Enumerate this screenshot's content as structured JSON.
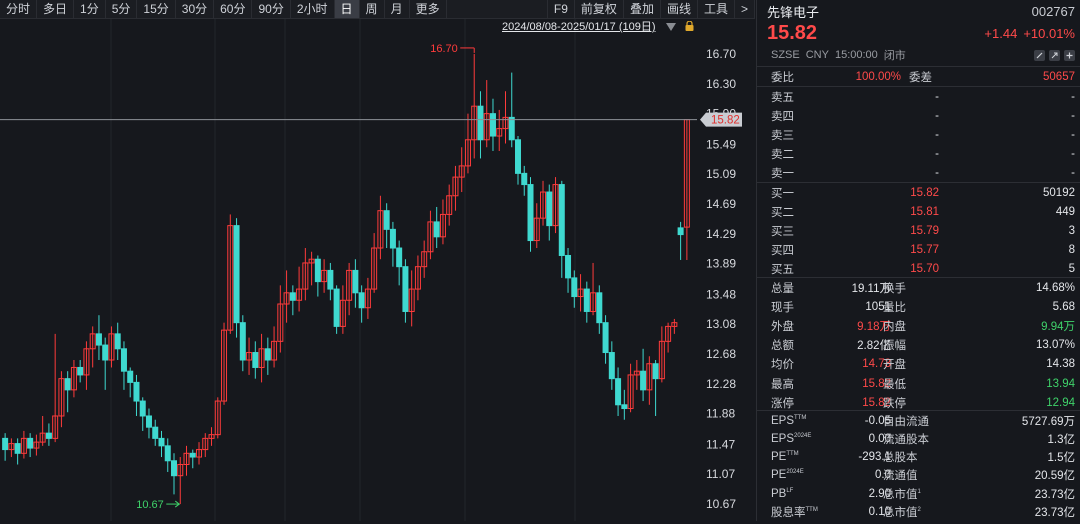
{
  "toolbar": {
    "tabs": [
      "分时",
      "多日",
      "1分",
      "5分",
      "15分",
      "30分",
      "60分",
      "90分",
      "2小时",
      "日",
      "周",
      "月",
      "更多"
    ],
    "active_index": 9,
    "right_tabs": [
      "F9",
      "前复权",
      "叠加",
      "画线",
      "工具",
      ">"
    ]
  },
  "chart": {
    "range_label": "2024/08/08-2025/01/17 (109日)",
    "price_axis": [
      "16.70",
      "16.30",
      "15.90",
      "15.49",
      "15.09",
      "14.69",
      "14.29",
      "13.89",
      "13.48",
      "13.08",
      "12.68",
      "12.28",
      "11.88",
      "11.47",
      "11.07",
      "10.67"
    ],
    "current_price_tag": "15.82",
    "high_marker": "16.70",
    "low_marker": "10.67",
    "colors": {
      "up": "#ff3b3b",
      "down": "#3fd9d0",
      "bg": "#16181d",
      "grid": "#23262c"
    }
  },
  "chart_data": {
    "type": "candlestick",
    "ylim": [
      10.47,
      16.9
    ],
    "candles": [
      {
        "o": 11.55,
        "c": 11.4,
        "h": 11.62,
        "l": 11.25
      },
      {
        "o": 11.4,
        "c": 11.48,
        "h": 11.55,
        "l": 11.3
      },
      {
        "o": 11.48,
        "c": 11.35,
        "h": 11.55,
        "l": 11.2
      },
      {
        "o": 11.35,
        "c": 11.55,
        "h": 11.65,
        "l": 11.28
      },
      {
        "o": 11.55,
        "c": 11.42,
        "h": 11.62,
        "l": 11.3
      },
      {
        "o": 11.42,
        "c": 11.5,
        "h": 11.6,
        "l": 11.32
      },
      {
        "o": 11.5,
        "c": 11.62,
        "h": 11.85,
        "l": 11.45
      },
      {
        "o": 11.62,
        "c": 11.55,
        "h": 11.75,
        "l": 11.45
      },
      {
        "o": 11.55,
        "c": 11.85,
        "h": 12.95,
        "l": 11.5
      },
      {
        "o": 11.85,
        "c": 12.35,
        "h": 12.45,
        "l": 11.7
      },
      {
        "o": 12.35,
        "c": 12.2,
        "h": 12.45,
        "l": 11.9
      },
      {
        "o": 12.2,
        "c": 12.5,
        "h": 12.6,
        "l": 12.1
      },
      {
        "o": 12.5,
        "c": 12.4,
        "h": 12.6,
        "l": 12.3
      },
      {
        "o": 12.4,
        "c": 12.75,
        "h": 12.85,
        "l": 12.2
      },
      {
        "o": 12.75,
        "c": 12.95,
        "h": 13.05,
        "l": 12.5
      },
      {
        "o": 12.95,
        "c": 12.8,
        "h": 13.2,
        "l": 12.6
      },
      {
        "o": 12.8,
        "c": 12.6,
        "h": 12.9,
        "l": 12.2
      },
      {
        "o": 12.6,
        "c": 12.95,
        "h": 13.05,
        "l": 12.5
      },
      {
        "o": 12.95,
        "c": 12.75,
        "h": 13.1,
        "l": 12.6
      },
      {
        "o": 12.75,
        "c": 12.45,
        "h": 12.85,
        "l": 12.2
      },
      {
        "o": 12.45,
        "c": 12.3,
        "h": 12.5,
        "l": 12.1
      },
      {
        "o": 12.3,
        "c": 12.05,
        "h": 12.4,
        "l": 11.85
      },
      {
        "o": 12.05,
        "c": 11.85,
        "h": 12.1,
        "l": 11.65
      },
      {
        "o": 11.85,
        "c": 11.7,
        "h": 11.95,
        "l": 11.55
      },
      {
        "o": 11.7,
        "c": 11.55,
        "h": 11.8,
        "l": 11.45
      },
      {
        "o": 11.55,
        "c": 11.45,
        "h": 11.65,
        "l": 11.3
      },
      {
        "o": 11.45,
        "c": 11.25,
        "h": 11.55,
        "l": 11.1
      },
      {
        "o": 11.25,
        "c": 11.05,
        "h": 11.35,
        "l": 10.8
      },
      {
        "o": 11.05,
        "c": 11.2,
        "h": 11.3,
        "l": 10.67
      },
      {
        "o": 11.2,
        "c": 11.35,
        "h": 11.45,
        "l": 11.05
      },
      {
        "o": 11.35,
        "c": 11.3,
        "h": 11.4,
        "l": 11.15
      },
      {
        "o": 11.3,
        "c": 11.4,
        "h": 11.5,
        "l": 11.2
      },
      {
        "o": 11.4,
        "c": 11.55,
        "h": 11.62,
        "l": 11.3
      },
      {
        "o": 11.55,
        "c": 11.6,
        "h": 11.7,
        "l": 11.45
      },
      {
        "o": 11.6,
        "c": 12.05,
        "h": 12.1,
        "l": 11.55
      },
      {
        "o": 12.05,
        "c": 13.0,
        "h": 13.1,
        "l": 12.0
      },
      {
        "o": 13.0,
        "c": 14.4,
        "h": 14.55,
        "l": 12.95
      },
      {
        "o": 14.4,
        "c": 13.1,
        "h": 14.5,
        "l": 12.9
      },
      {
        "o": 13.1,
        "c": 12.6,
        "h": 13.2,
        "l": 12.45
      },
      {
        "o": 12.6,
        "c": 12.7,
        "h": 12.9,
        "l": 12.4
      },
      {
        "o": 12.7,
        "c": 12.5,
        "h": 12.85,
        "l": 12.35
      },
      {
        "o": 12.5,
        "c": 12.75,
        "h": 12.95,
        "l": 12.3
      },
      {
        "o": 12.75,
        "c": 12.6,
        "h": 12.9,
        "l": 12.4
      },
      {
        "o": 12.6,
        "c": 12.85,
        "h": 13.05,
        "l": 12.5
      },
      {
        "o": 12.85,
        "c": 13.35,
        "h": 13.6,
        "l": 12.7
      },
      {
        "o": 13.35,
        "c": 13.5,
        "h": 13.8,
        "l": 13.1
      },
      {
        "o": 13.5,
        "c": 13.4,
        "h": 13.6,
        "l": 13.2
      },
      {
        "o": 13.4,
        "c": 13.55,
        "h": 13.85,
        "l": 13.25
      },
      {
        "o": 13.55,
        "c": 13.9,
        "h": 14.1,
        "l": 13.4
      },
      {
        "o": 13.9,
        "c": 13.95,
        "h": 14.05,
        "l": 13.6
      },
      {
        "o": 13.95,
        "c": 13.65,
        "h": 14.0,
        "l": 13.45
      },
      {
        "o": 13.65,
        "c": 13.8,
        "h": 13.95,
        "l": 13.5
      },
      {
        "o": 13.8,
        "c": 13.55,
        "h": 13.9,
        "l": 13.4
      },
      {
        "o": 13.55,
        "c": 13.05,
        "h": 13.6,
        "l": 12.95
      },
      {
        "o": 13.05,
        "c": 13.4,
        "h": 13.6,
        "l": 12.95
      },
      {
        "o": 13.4,
        "c": 13.8,
        "h": 13.9,
        "l": 13.2
      },
      {
        "o": 13.8,
        "c": 13.5,
        "h": 13.95,
        "l": 13.3
      },
      {
        "o": 13.5,
        "c": 13.3,
        "h": 13.6,
        "l": 13.1
      },
      {
        "o": 13.3,
        "c": 13.55,
        "h": 13.7,
        "l": 13.15
      },
      {
        "o": 13.55,
        "c": 14.1,
        "h": 14.3,
        "l": 13.5
      },
      {
        "o": 14.1,
        "c": 14.6,
        "h": 14.8,
        "l": 13.95
      },
      {
        "o": 14.6,
        "c": 14.35,
        "h": 14.7,
        "l": 14.1
      },
      {
        "o": 14.35,
        "c": 14.1,
        "h": 14.45,
        "l": 13.85
      },
      {
        "o": 14.1,
        "c": 13.85,
        "h": 14.2,
        "l": 13.6
      },
      {
        "o": 13.85,
        "c": 13.25,
        "h": 13.95,
        "l": 13.1
      },
      {
        "o": 13.25,
        "c": 13.55,
        "h": 13.8,
        "l": 13.05
      },
      {
        "o": 13.55,
        "c": 13.85,
        "h": 14.0,
        "l": 13.4
      },
      {
        "o": 13.85,
        "c": 14.05,
        "h": 14.2,
        "l": 13.7
      },
      {
        "o": 14.05,
        "c": 14.45,
        "h": 14.6,
        "l": 13.95
      },
      {
        "o": 14.45,
        "c": 14.25,
        "h": 14.65,
        "l": 14.1
      },
      {
        "o": 14.25,
        "c": 14.55,
        "h": 14.75,
        "l": 14.15
      },
      {
        "o": 14.55,
        "c": 14.8,
        "h": 14.95,
        "l": 14.4
      },
      {
        "o": 14.8,
        "c": 15.05,
        "h": 15.2,
        "l": 14.6
      },
      {
        "o": 15.05,
        "c": 15.2,
        "h": 15.45,
        "l": 14.85
      },
      {
        "o": 15.2,
        "c": 15.55,
        "h": 15.9,
        "l": 15.1
      },
      {
        "o": 15.55,
        "c": 16.0,
        "h": 16.7,
        "l": 15.3
      },
      {
        "o": 16.0,
        "c": 15.55,
        "h": 16.2,
        "l": 15.3
      },
      {
        "o": 15.55,
        "c": 15.9,
        "h": 16.35,
        "l": 15.45
      },
      {
        "o": 15.9,
        "c": 15.6,
        "h": 16.1,
        "l": 15.4
      },
      {
        "o": 15.6,
        "c": 15.7,
        "h": 15.95,
        "l": 15.4
      },
      {
        "o": 15.7,
        "c": 15.85,
        "h": 16.2,
        "l": 15.5
      },
      {
        "o": 15.85,
        "c": 15.55,
        "h": 16.45,
        "l": 15.45
      },
      {
        "o": 15.55,
        "c": 15.1,
        "h": 15.6,
        "l": 14.95
      },
      {
        "o": 15.1,
        "c": 14.95,
        "h": 15.2,
        "l": 14.8
      },
      {
        "o": 14.95,
        "c": 14.2,
        "h": 15.05,
        "l": 14.05
      },
      {
        "o": 14.2,
        "c": 14.5,
        "h": 14.7,
        "l": 14.1
      },
      {
        "o": 14.5,
        "c": 14.85,
        "h": 15.0,
        "l": 14.4
      },
      {
        "o": 14.85,
        "c": 14.4,
        "h": 14.95,
        "l": 14.2
      },
      {
        "o": 14.4,
        "c": 14.95,
        "h": 15.05,
        "l": 14.3
      },
      {
        "o": 14.95,
        "c": 14.0,
        "h": 15.0,
        "l": 13.7
      },
      {
        "o": 14.0,
        "c": 13.7,
        "h": 14.1,
        "l": 13.5
      },
      {
        "o": 13.7,
        "c": 13.45,
        "h": 13.8,
        "l": 13.3
      },
      {
        "o": 13.45,
        "c": 13.55,
        "h": 13.75,
        "l": 13.25
      },
      {
        "o": 13.55,
        "c": 13.25,
        "h": 13.65,
        "l": 13.1
      },
      {
        "o": 13.25,
        "c": 13.5,
        "h": 13.9,
        "l": 13.2
      },
      {
        "o": 13.5,
        "c": 13.1,
        "h": 13.6,
        "l": 12.95
      },
      {
        "o": 13.1,
        "c": 12.7,
        "h": 13.2,
        "l": 12.55
      },
      {
        "o": 12.7,
        "c": 12.35,
        "h": 12.85,
        "l": 12.2
      },
      {
        "o": 12.35,
        "c": 12.0,
        "h": 12.5,
        "l": 11.85
      },
      {
        "o": 12.0,
        "c": 11.95,
        "h": 12.2,
        "l": 11.8
      },
      {
        "o": 11.95,
        "c": 12.4,
        "h": 12.55,
        "l": 11.9
      },
      {
        "o": 12.4,
        "c": 12.45,
        "h": 12.6,
        "l": 12.2
      },
      {
        "o": 12.45,
        "c": 12.2,
        "h": 12.75,
        "l": 12.05
      },
      {
        "o": 12.2,
        "c": 12.55,
        "h": 12.65,
        "l": 12.0
      },
      {
        "o": 12.55,
        "c": 12.35,
        "h": 12.6,
        "l": 11.85
      },
      {
        "o": 12.35,
        "c": 12.85,
        "h": 13.05,
        "l": 12.3
      },
      {
        "o": 12.85,
        "c": 13.05,
        "h": 13.1,
        "l": 12.7
      },
      {
        "o": 13.05,
        "c": 13.1,
        "h": 13.15,
        "l": 12.95
      },
      {
        "o": 14.37,
        "c": 14.28,
        "h": 14.45,
        "l": 13.94
      },
      {
        "o": 14.38,
        "c": 15.82,
        "h": 15.82,
        "l": 13.94
      }
    ]
  },
  "header": {
    "name": "先锋电子",
    "code": "002767",
    "price": "15.82",
    "change": "+1.44",
    "change_pct": "+10.01%",
    "market": [
      "SZSE",
      "CNY",
      "15:00:00",
      "闭市"
    ]
  },
  "weibi": {
    "label1": "委比",
    "value1": "100.00%",
    "label2": "委差",
    "value2": "50657"
  },
  "sells": [
    {
      "label": "卖五",
      "price": "-",
      "vol": "-"
    },
    {
      "label": "卖四",
      "price": "-",
      "vol": "-"
    },
    {
      "label": "卖三",
      "price": "-",
      "vol": "-"
    },
    {
      "label": "卖二",
      "price": "-",
      "vol": "-"
    },
    {
      "label": "卖一",
      "price": "-",
      "vol": "-"
    }
  ],
  "buys": [
    {
      "label": "买一",
      "price": "15.82",
      "vol": "50192"
    },
    {
      "label": "买二",
      "price": "15.81",
      "vol": "449"
    },
    {
      "label": "买三",
      "price": "15.79",
      "vol": "3"
    },
    {
      "label": "买四",
      "price": "15.77",
      "vol": "8"
    },
    {
      "label": "买五",
      "price": "15.70",
      "vol": "5"
    }
  ],
  "stats": [
    {
      "l1": "总量",
      "v1": "19.11万",
      "c1": "w",
      "l2": "换手",
      "v2": "14.68%",
      "c2": "w"
    },
    {
      "l1": "现手",
      "v1": "1051",
      "c1": "w",
      "l2": "量比",
      "v2": "5.68",
      "c2": "w"
    },
    {
      "l1": "外盘",
      "v1": "9.18万",
      "c1": "red",
      "l2": "内盘",
      "v2": "9.94万",
      "c2": "green"
    },
    {
      "l1": "总额",
      "v1": "2.82亿",
      "c1": "w",
      "l2": "振幅",
      "v2": "13.07%",
      "c2": "w"
    },
    {
      "l1": "均价",
      "v1": "14.73",
      "c1": "red",
      "l2": "开盘",
      "v2": "14.38",
      "c2": "w"
    },
    {
      "l1": "最高",
      "v1": "15.82",
      "c1": "red",
      "l2": "最低",
      "v2": "13.94",
      "c2": "green"
    },
    {
      "l1": "涨停",
      "v1": "15.82",
      "c1": "red",
      "l2": "跌停",
      "v2": "12.94",
      "c2": "green"
    }
  ],
  "fundamentals": [
    {
      "l1": "EPS",
      "s1": "TTM",
      "v1": "-0.05",
      "l2": "自由流通",
      "s2": "",
      "v2": "5727.69万"
    },
    {
      "l1": "EPS",
      "s1": "2024E",
      "v1": "0.00",
      "l2": "流通股本",
      "s2": "",
      "v2": "1.3亿"
    },
    {
      "l1": "PE",
      "s1": "TTM",
      "v1": "-293.1",
      "l2": "总股本",
      "s2": "",
      "v2": "1.5亿"
    },
    {
      "l1": "PE",
      "s1": "2024E",
      "v1": "0.0",
      "l2": "流通值",
      "s2": "",
      "v2": "20.59亿"
    },
    {
      "l1": "PB",
      "s1": "LF",
      "v1": "2.90",
      "l2": "总市值",
      "s2": "1",
      "v2": "23.73亿"
    },
    {
      "l1": "股息率",
      "s1": "TTM",
      "v1": "0.10",
      "l2": "总市值",
      "s2": "2",
      "v2": "23.73亿"
    }
  ]
}
